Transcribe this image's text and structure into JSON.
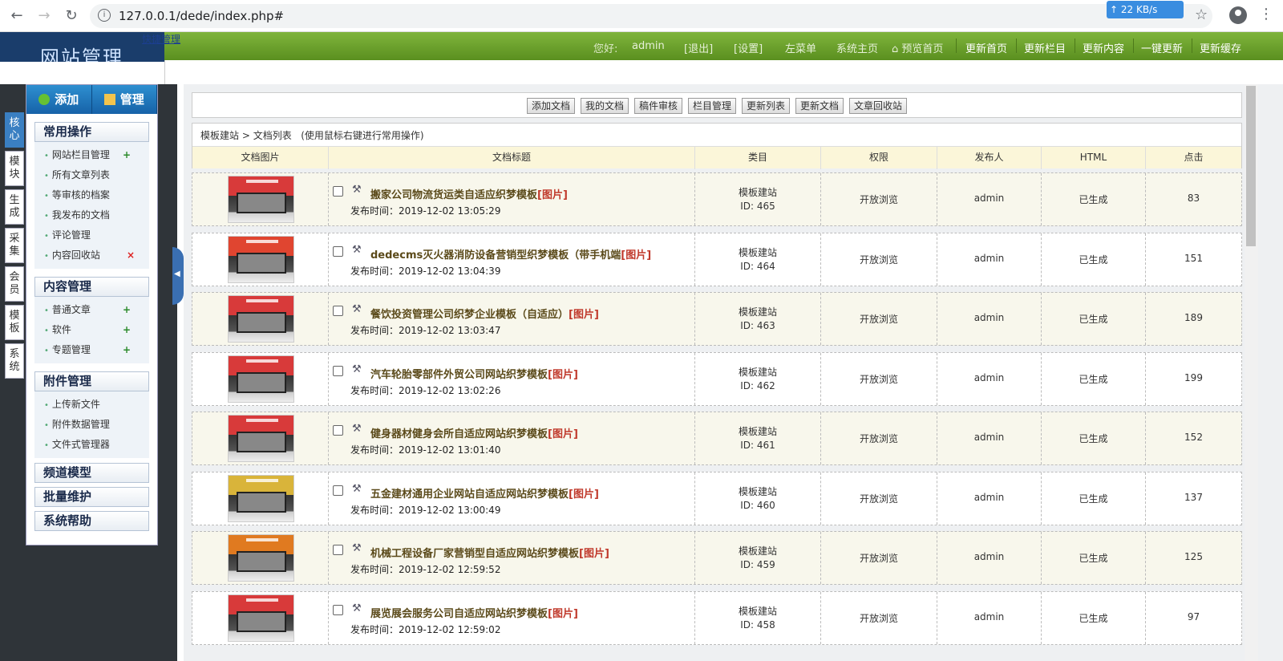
{
  "browser": {
    "url": "127.0.0.1/dede/index.php#",
    "speed": "22 KB/s"
  },
  "header": {
    "logo": "网站管理",
    "quick_link": "快捷管理",
    "welcome_label": "您好:",
    "user": "admin",
    "logout": "[退出]",
    "settings": "[设置]",
    "left_menu": "左菜单",
    "system_home": "系统主页",
    "preview_home": "预览首页",
    "actions": [
      "更新首页",
      "更新栏目",
      "更新内容",
      "一键更新",
      "更新缓存"
    ]
  },
  "sidebar": {
    "tabs": [
      "核心",
      "模块",
      "生成",
      "采集",
      "会员",
      "模板",
      "系统"
    ],
    "add_btn": "添加",
    "manage_btn": "管理",
    "sections": [
      {
        "title": "常用操作",
        "items": [
          "网站栏目管理",
          "所有文章列表",
          "等审核的档案",
          "我发布的文档",
          "评论管理",
          "内容回收站"
        ]
      },
      {
        "title": "内容管理",
        "items": [
          "普通文章",
          "软件",
          "专题管理"
        ]
      },
      {
        "title": "附件管理",
        "items": [
          "上传新文件",
          "附件数据管理",
          "文件式管理器"
        ]
      }
    ],
    "collapsed": [
      "频道模型",
      "批量维护",
      "系统帮助"
    ]
  },
  "toolbar": [
    "添加文档",
    "我的文档",
    "稿件审核",
    "栏目管理",
    "更新列表",
    "更新文档",
    "文章回收站"
  ],
  "breadcrumb": {
    "root": "模板建站",
    "sep": ">",
    "current": "文档列表",
    "hint": "(使用鼠标右键进行常用操作)"
  },
  "table": {
    "columns": [
      "文档图片",
      "文档标题",
      "类目",
      "权限",
      "发布人",
      "HTML",
      "点击"
    ],
    "rows": [
      {
        "title": "搬家公司物流货运类自适应织梦模板",
        "tag": "[图片]",
        "time": "发布时间：2019-12-02 13:05:29",
        "category": "模板建站",
        "id": "ID: 465",
        "perm": "开放浏览",
        "author": "admin",
        "html": "已生成",
        "clicks": "83",
        "color": "#d83a3a"
      },
      {
        "title": "dedecms灭火器消防设备营销型织梦模板（带手机端",
        "tag": "[图片]",
        "time": "发布时间：2019-12-02 13:04:39",
        "category": "模板建站",
        "id": "ID: 464",
        "perm": "开放浏览",
        "author": "admin",
        "html": "已生成",
        "clicks": "151",
        "color": "#e04530"
      },
      {
        "title": "餐饮投资管理公司织梦企业模板（自适应）",
        "tag": "[图片]",
        "time": "发布时间：2019-12-02 13:03:47",
        "category": "模板建站",
        "id": "ID: 463",
        "perm": "开放浏览",
        "author": "admin",
        "html": "已生成",
        "clicks": "189",
        "color": "#d83a3a"
      },
      {
        "title": "汽车轮胎零部件外贸公司网站织梦模板",
        "tag": "[图片]",
        "time": "发布时间：2019-12-02 13:02:26",
        "category": "模板建站",
        "id": "ID: 462",
        "perm": "开放浏览",
        "author": "admin",
        "html": "已生成",
        "clicks": "199",
        "color": "#d83a3a"
      },
      {
        "title": "健身器材健身会所自适应网站织梦模板",
        "tag": "[图片]",
        "time": "发布时间：2019-12-02 13:01:40",
        "category": "模板建站",
        "id": "ID: 461",
        "perm": "开放浏览",
        "author": "admin",
        "html": "已生成",
        "clicks": "152",
        "color": "#d83a3a"
      },
      {
        "title": "五金建材通用企业网站自适应网站织梦模板",
        "tag": "[图片]",
        "time": "发布时间：2019-12-02 13:00:49",
        "category": "模板建站",
        "id": "ID: 460",
        "perm": "开放浏览",
        "author": "admin",
        "html": "已生成",
        "clicks": "137",
        "color": "#d9b43a"
      },
      {
        "title": "机械工程设备厂家营销型自适应网站织梦模板",
        "tag": "[图片]",
        "time": "发布时间：2019-12-02 12:59:52",
        "category": "模板建站",
        "id": "ID: 459",
        "perm": "开放浏览",
        "author": "admin",
        "html": "已生成",
        "clicks": "125",
        "color": "#e07a20"
      },
      {
        "title": "展览展会服务公司自适应网站织梦模板",
        "tag": "[图片]",
        "time": "发布时间：2019-12-02 12:59:02",
        "category": "模板建站",
        "id": "ID: 458",
        "perm": "开放浏览",
        "author": "admin",
        "html": "已生成",
        "clicks": "97",
        "color": "#d83a3a"
      }
    ]
  }
}
